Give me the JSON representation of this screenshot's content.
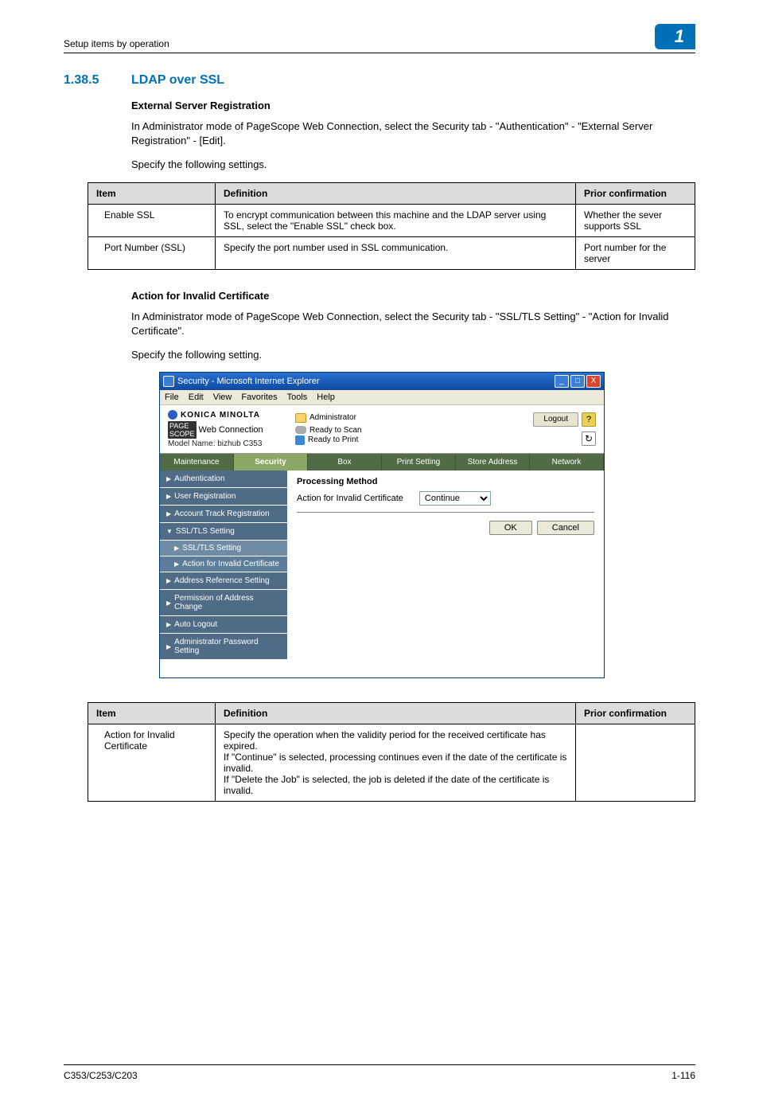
{
  "header": {
    "breadcrumb": "Setup items by operation",
    "badge": "1"
  },
  "section": {
    "number": "1.38.5",
    "title": "LDAP over SSL",
    "sub1": {
      "heading": "External Server Registration",
      "p1": "In Administrator mode of PageScope Web Connection, select the Security tab - \"Authentication\" - \"External Server Registration\" - [Edit].",
      "p2": "Specify the following settings."
    },
    "sub2": {
      "heading": "Action for Invalid Certificate",
      "p1": "In Administrator mode of PageScope Web Connection, select the Security tab - \"SSL/TLS Setting\" - \"Action for Invalid Certificate\".",
      "p2": "Specify the following setting."
    }
  },
  "table1": {
    "headers": {
      "c1": "Item",
      "c2": "Definition",
      "c3": "Prior confirmation"
    },
    "rows": [
      {
        "c1": "Enable SSL",
        "c2": "To encrypt communication between this machine and the LDAP server using SSL, select the \"Enable SSL\" check box.",
        "c3": "Whether the sever supports SSL"
      },
      {
        "c1": "Port Number (SSL)",
        "c2": "Specify the port number used in SSL communication.",
        "c3": "Port number for the server"
      }
    ]
  },
  "table2": {
    "headers": {
      "c1": "Item",
      "c2": "Definition",
      "c3": "Prior confirmation"
    },
    "rows": [
      {
        "c1": "Action for Invalid Certificate",
        "c2": "Specify the operation when the validity period for the received certificate has expired.\nIf \"Continue\" is selected, processing continues even if the date of the certificate is invalid.\nIf \"Delete the Job\" is selected, the job is deleted if the date of the certificate is invalid.",
        "c3": ""
      }
    ]
  },
  "ie": {
    "title": "Security - Microsoft Internet Explorer",
    "menu": {
      "file": "File",
      "edit": "Edit",
      "view": "View",
      "favorites": "Favorites",
      "tools": "Tools",
      "help": "Help"
    },
    "wc": {
      "brand": "KONICA MINOLTA",
      "connection": "Web Connection",
      "model": "Model Name: bizhub C353",
      "admin": "Administrator",
      "ready_scan": "Ready to Scan",
      "ready_print": "Ready to Print",
      "logout": "Logout",
      "help": "?",
      "tabs": {
        "maintenance": "Maintenance",
        "security": "Security",
        "box": "Box",
        "print_setting": "Print Setting",
        "store_address": "Store Address",
        "network": "Network"
      },
      "sidebar": {
        "authentication": "Authentication",
        "user_registration": "User Registration",
        "account_track": "Account Track Registration",
        "ssl_tls_setting": "SSL/TLS Setting",
        "ssl_tls_sub": "SSL/TLS Setting",
        "action_invalid": "Action for Invalid Certificate",
        "address_ref": "Address Reference Setting",
        "permission": "Permission of Address Change",
        "auto_logout": "Auto Logout",
        "admin_pwd": "Administrator Password Setting"
      },
      "main": {
        "processing_method": "Processing Method",
        "action_label": "Action for Invalid Certificate",
        "action_value": "Continue",
        "ok": "OK",
        "cancel": "Cancel"
      }
    }
  },
  "footer": {
    "left": "C353/C253/C203",
    "right": "1-116"
  }
}
